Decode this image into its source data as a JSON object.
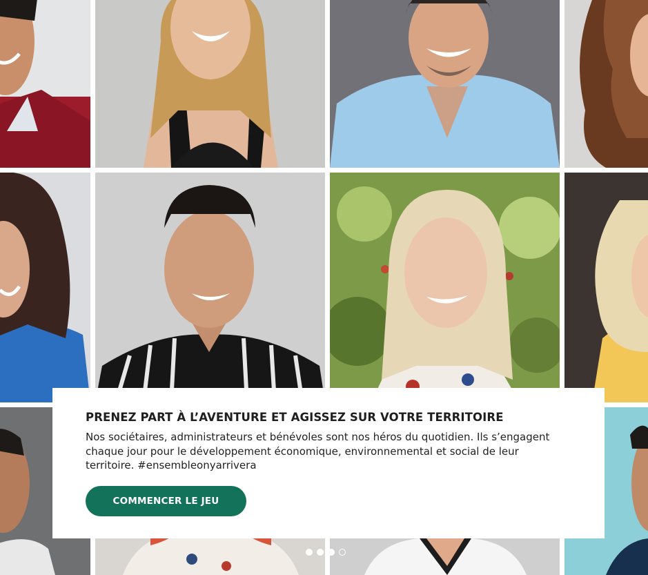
{
  "hero": {
    "title": "PRENEZ PART À L’AVENTURE ET AGISSEZ SUR VOTRE TERRITOIRE",
    "body": "Nos sociétaires, administrateurs et bénévoles sont nos héros du quotidien. Ils s’engagent chaque jour pour le développement économique, environnemental et social de leur territoire. #ensembleonyarrivera",
    "cta_label": "COMMENCER LE JEU"
  },
  "carousel": {
    "slide_count": 4,
    "active_slide": 3
  },
  "colors": {
    "cta_background": "#12725a",
    "card_background": "#ffffff"
  }
}
